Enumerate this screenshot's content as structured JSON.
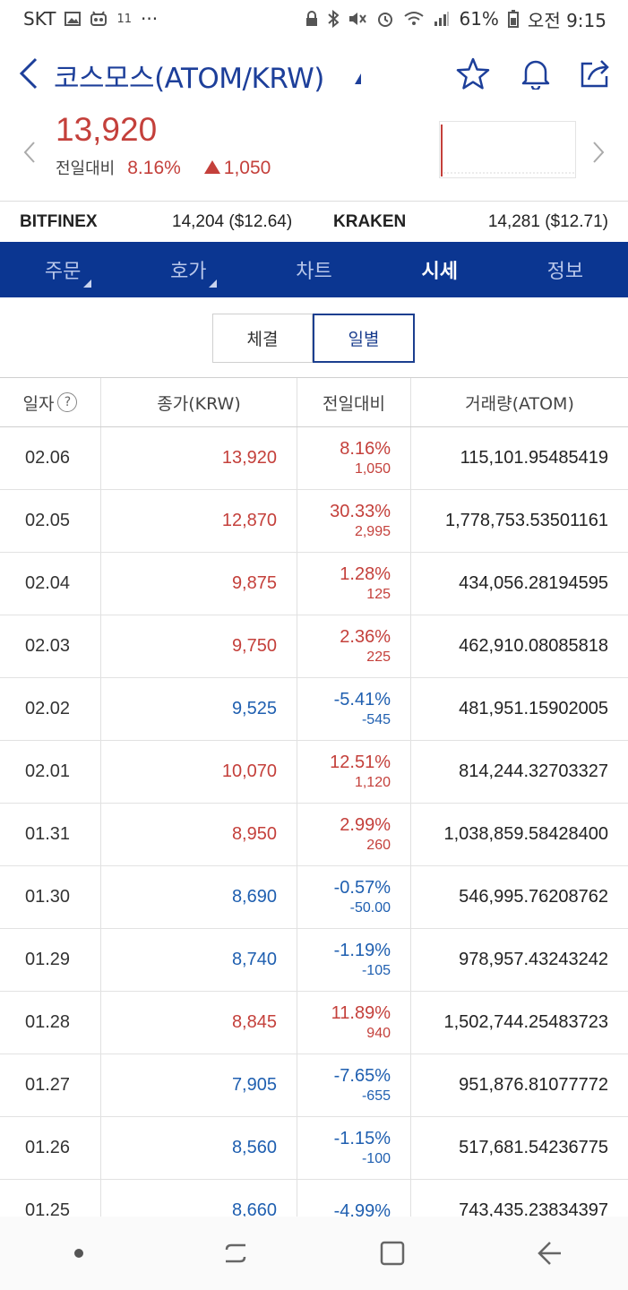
{
  "status_bar": {
    "carrier": "SKT",
    "extra": "11",
    "more": "···",
    "battery": "61%",
    "time": "오전 9:15"
  },
  "header": {
    "title": "코스모스(ATOM/KRW)"
  },
  "price": {
    "current": "13,920",
    "change_label": "전일대비",
    "change_pct": "8.16%",
    "change_amount": "1,050"
  },
  "exchanges": [
    {
      "name": "BITFINEX",
      "value": "14,204 ($12.64)"
    },
    {
      "name": "KRAKEN",
      "value": "14,281 ($12.71)"
    }
  ],
  "tabs": [
    {
      "label": "주문"
    },
    {
      "label": "호가"
    },
    {
      "label": "차트"
    },
    {
      "label": "시세"
    },
    {
      "label": "정보"
    }
  ],
  "segment": {
    "trades": "체결",
    "daily": "일별"
  },
  "table": {
    "headers": [
      "일자",
      "종가(KRW)",
      "전일대비",
      "거래량(ATOM)"
    ],
    "help_glyph": "?",
    "rows": [
      {
        "date": "02.06",
        "close": "13,920",
        "pct": "8.16%",
        "amt": "1,050",
        "vol": "115,101.95485419",
        "dir": "up"
      },
      {
        "date": "02.05",
        "close": "12,870",
        "pct": "30.33%",
        "amt": "2,995",
        "vol": "1,778,753.53501161",
        "dir": "up"
      },
      {
        "date": "02.04",
        "close": "9,875",
        "pct": "1.28%",
        "amt": "125",
        "vol": "434,056.28194595",
        "dir": "up"
      },
      {
        "date": "02.03",
        "close": "9,750",
        "pct": "2.36%",
        "amt": "225",
        "vol": "462,910.08085818",
        "dir": "up"
      },
      {
        "date": "02.02",
        "close": "9,525",
        "pct": "-5.41%",
        "amt": "-545",
        "vol": "481,951.15902005",
        "dir": "down"
      },
      {
        "date": "02.01",
        "close": "10,070",
        "pct": "12.51%",
        "amt": "1,120",
        "vol": "814,244.32703327",
        "dir": "up"
      },
      {
        "date": "01.31",
        "close": "8,950",
        "pct": "2.99%",
        "amt": "260",
        "vol": "1,038,859.58428400",
        "dir": "up"
      },
      {
        "date": "01.30",
        "close": "8,690",
        "pct": "-0.57%",
        "amt": "-50.00",
        "vol": "546,995.76208762",
        "dir": "down"
      },
      {
        "date": "01.29",
        "close": "8,740",
        "pct": "-1.19%",
        "amt": "-105",
        "vol": "978,957.43243242",
        "dir": "down"
      },
      {
        "date": "01.28",
        "close": "8,845",
        "pct": "11.89%",
        "amt": "940",
        "vol": "1,502,744.25483723",
        "dir": "up"
      },
      {
        "date": "01.27",
        "close": "7,905",
        "pct": "-7.65%",
        "amt": "-655",
        "vol": "951,876.81077772",
        "dir": "down"
      },
      {
        "date": "01.26",
        "close": "8,560",
        "pct": "-1.15%",
        "amt": "-100",
        "vol": "517,681.54236775",
        "dir": "down"
      },
      {
        "date": "01.25",
        "close": "8,660",
        "pct": "-4.99%",
        "amt": "",
        "vol": "743,435.23834397",
        "dir": "down"
      }
    ]
  },
  "colors": {
    "up": "#c4403b",
    "down": "#1f5fb0",
    "brand": "#0b3691"
  }
}
